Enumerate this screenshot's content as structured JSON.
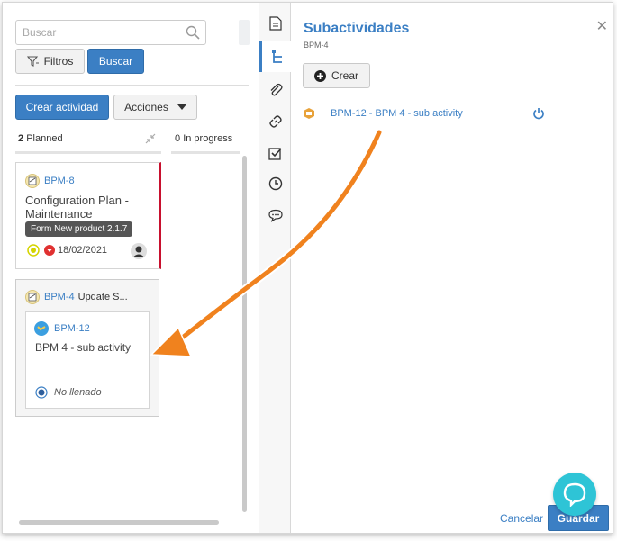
{
  "toolbar": {
    "search_placeholder": "Buscar",
    "filters_label": "Filtros",
    "search_button_label": "Buscar",
    "create_activity_label": "Crear actividad",
    "actions_label": "Acciones"
  },
  "columns": [
    {
      "count": "2",
      "name": "Planned"
    },
    {
      "count": "0",
      "name": "In progress"
    }
  ],
  "cards": [
    {
      "id": "BPM-8",
      "title": "Configuration Plan - Maintenance",
      "tooltip": "Form New product 2.1.7",
      "date": "18/02/2021"
    },
    {
      "id": "BPM-4",
      "title": "Update S...",
      "child": {
        "id": "BPM-12",
        "title": "BPM 4 - sub activity",
        "status": "No llenado"
      }
    }
  ],
  "panel": {
    "title": "Subactividades",
    "subtitle": "BPM-4",
    "create_label": "Crear",
    "subactivities": [
      {
        "label": "BPM-12 - BPM 4 - sub activity"
      }
    ],
    "cancel_label": "Cancelar",
    "save_label": "Guardar"
  },
  "colors": {
    "primary": "#3b7fc4",
    "card_accent": "#c8102e",
    "arrow": "#f0821e",
    "chat": "#2ec4d6"
  },
  "icons": [
    "search-icon",
    "filter-icon",
    "collapse-icon",
    "task-icon",
    "avatar",
    "document-icon",
    "hierarchy-icon",
    "paperclip-icon",
    "link-icon",
    "checklist-icon",
    "clock-icon",
    "comment-icon",
    "plus-icon",
    "power-icon",
    "close-icon",
    "chat-icon"
  ]
}
